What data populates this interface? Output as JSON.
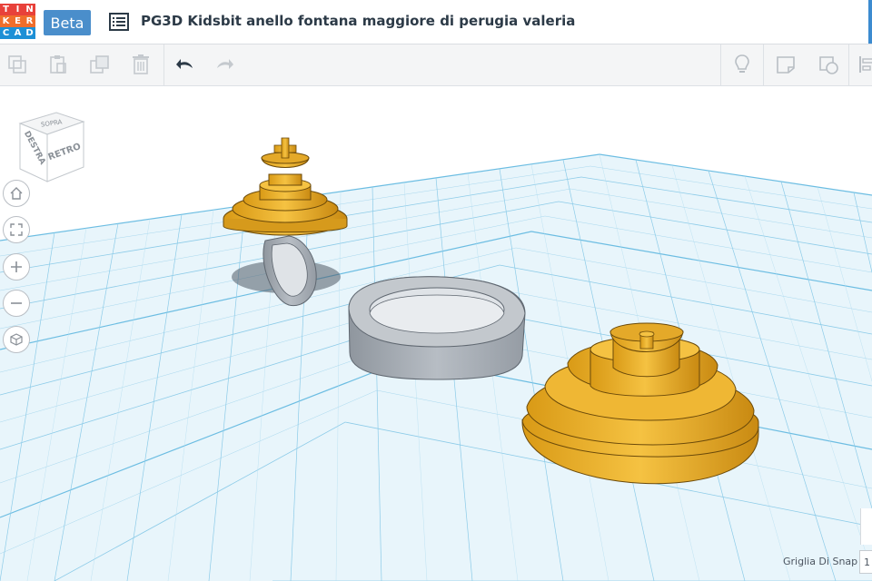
{
  "header": {
    "logo_letters": [
      "T",
      "I",
      "N",
      "K",
      "E",
      "R",
      "C",
      "A",
      "D"
    ],
    "logo_colors": [
      "#e8413a",
      "#e8413a",
      "#e8413a",
      "#f06e2c",
      "#f06e2c",
      "#f06e2c",
      "#1e90d6",
      "#1e90d6",
      "#1e90d6"
    ],
    "beta_label": "Beta",
    "title": "PG3D Kidsbit anello fontana maggiore di perugia valeria",
    "list_icon": "list-icon"
  },
  "toolbar": {
    "icons": [
      "copy-icon",
      "paste-icon",
      "duplicate-icon",
      "delete-icon",
      "undo-icon",
      "redo-icon",
      "light-bulb-icon",
      "note-icon",
      "shapes-icon",
      "align-icon"
    ]
  },
  "viewcube": {
    "front_label": "DESTRA",
    "right_label": "RETRO",
    "top_label": "SOPRA"
  },
  "nav": {
    "icons": [
      "home-icon",
      "fit-view-icon",
      "zoom-in-icon",
      "zoom-out-icon",
      "perspective-icon"
    ]
  },
  "footer": {
    "snap_label": "Griglia Di Snap",
    "snap_value": "1"
  },
  "colors": {
    "grid_blue": "#7fc6e6",
    "shape_gold": "#f2b82d",
    "ring_gray": "#a9b0b8",
    "accent": "#4a8ecb"
  }
}
